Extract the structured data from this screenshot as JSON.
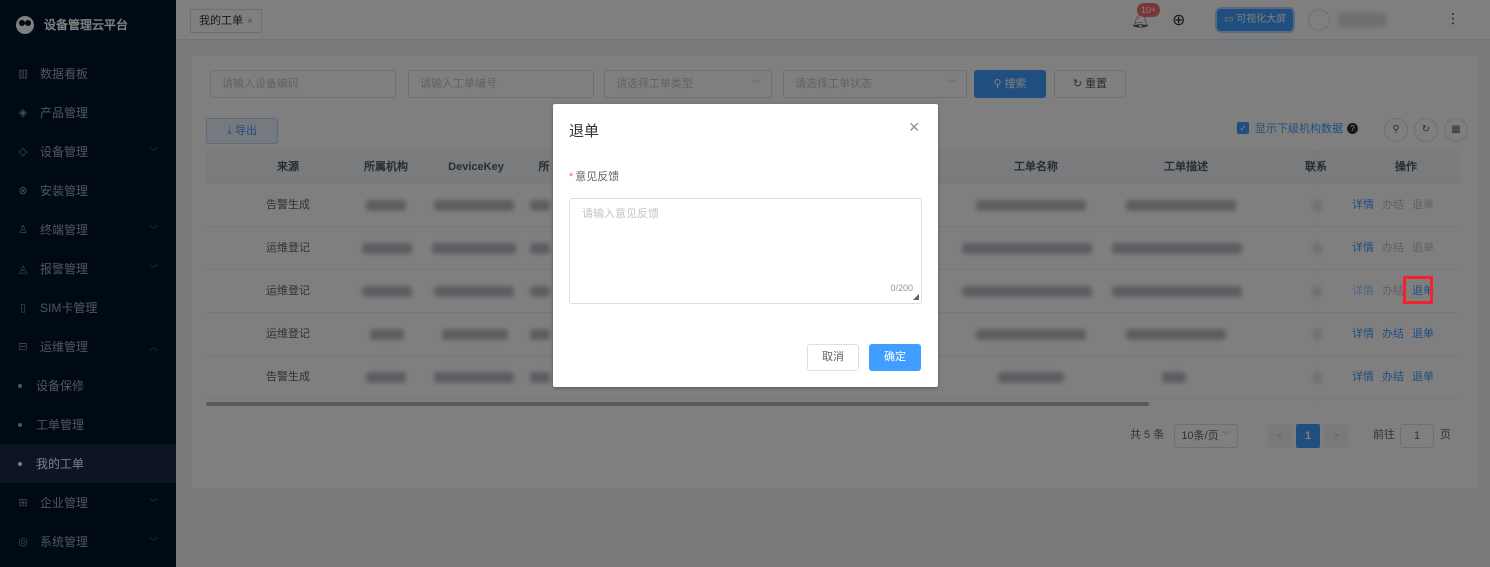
{
  "app": {
    "title": "设备管理云平台"
  },
  "sidebar": {
    "items": [
      {
        "label": "数据看板",
        "icon": "chart-icon"
      },
      {
        "label": "产品管理",
        "icon": "cube-icon"
      },
      {
        "label": "设备管理",
        "icon": "layers-icon",
        "expandable": true
      },
      {
        "label": "安装管理",
        "icon": "wrench-icon"
      },
      {
        "label": "终端管理",
        "icon": "user-icon",
        "expandable": true
      },
      {
        "label": "报警管理",
        "icon": "alarm-icon",
        "expandable": true
      },
      {
        "label": "SIM卡管理",
        "icon": "sim-icon"
      },
      {
        "label": "运维管理",
        "icon": "maintenance-icon",
        "expanded": true
      },
      {
        "label": "设备保修",
        "sub": true
      },
      {
        "label": "工单管理",
        "sub": true
      },
      {
        "label": "我的工单",
        "sub": true,
        "active": true
      },
      {
        "label": "企业管理",
        "icon": "building-icon",
        "expandable": true
      },
      {
        "label": "系统管理",
        "icon": "settings-icon",
        "expandable": true
      }
    ]
  },
  "topbar": {
    "tab_label": "我的工单",
    "notification_badge": "10+",
    "bigscreen_label": "可视化大屏"
  },
  "filters": {
    "device_code_placeholder": "请输入设备编码",
    "order_no_placeholder": "请输入工单编号",
    "order_type_placeholder": "请选择工单类型",
    "order_status_placeholder": "请选择工单状态",
    "search_label": "搜索",
    "reset_label": "重置"
  },
  "toolbar": {
    "export_label": "导出",
    "sub_org_label": "显示下级机构数据"
  },
  "table": {
    "columns": [
      "来源",
      "所属机构",
      "DeviceKey",
      "所",
      "工单名称",
      "工单描述",
      "联系",
      "操作"
    ],
    "rows": [
      {
        "source": "告警生成",
        "actions": [
          "详情",
          "办结",
          "退单"
        ],
        "actions_enabled": false
      },
      {
        "source": "运维登记",
        "actions": [
          "详情",
          "办结",
          "退单"
        ],
        "actions_enabled": false
      },
      {
        "source": "运维登记",
        "actions": [
          "详情",
          "办结",
          "退单"
        ],
        "actions_enabled": false,
        "highlighted_action": "退单"
      },
      {
        "source": "运维登记",
        "actions": [
          "详情",
          "办结",
          "退单"
        ],
        "actions_enabled": true
      },
      {
        "source": "告警生成",
        "actions": [
          "详情",
          "办结",
          "退单"
        ],
        "actions_enabled": true
      }
    ]
  },
  "pagination": {
    "total": "共 5 条",
    "page_size": "10条/页",
    "prev": "<",
    "current_page": "1",
    "next": ">",
    "goto_label": "前往",
    "goto_value": "1",
    "page_suffix": "页"
  },
  "dialog": {
    "title": "退单",
    "field_label": "意见反馈",
    "required_mark": "*",
    "placeholder": "请输入意见反馈",
    "counter": "0/200",
    "cancel_label": "取消",
    "confirm_label": "确定"
  },
  "colors": {
    "primary": "#409eff",
    "sidebar_bg": "#001529",
    "danger": "#f5222d"
  }
}
